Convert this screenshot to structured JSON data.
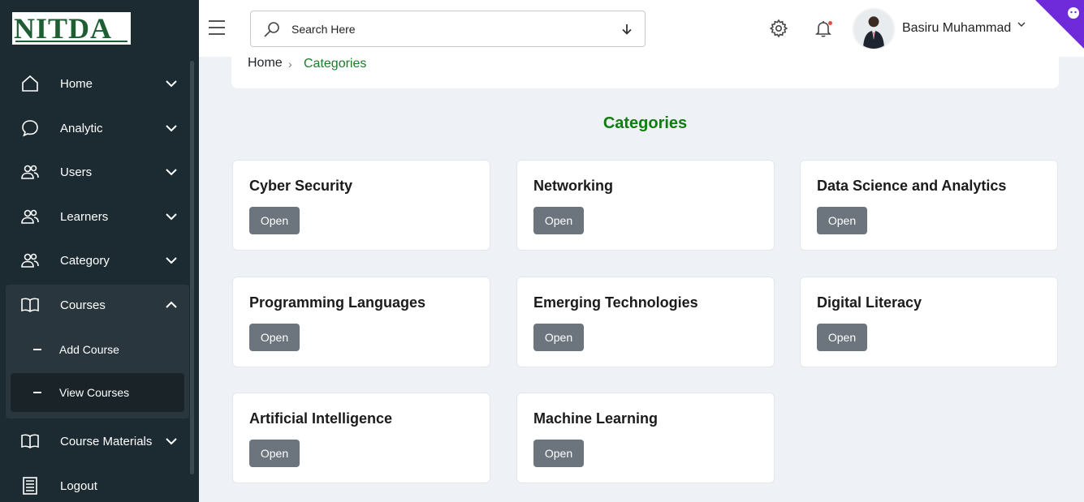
{
  "brand": {
    "logo_text": "NITDA"
  },
  "sidebar": {
    "items": [
      {
        "label": "Home",
        "icon": "home-icon"
      },
      {
        "label": "Analytic",
        "icon": "chat-bubble-icon"
      },
      {
        "label": "Users",
        "icon": "users-icon"
      },
      {
        "label": "Learners",
        "icon": "users-icon"
      },
      {
        "label": "Category",
        "icon": "users-icon"
      },
      {
        "label": "Courses",
        "icon": "book-icon",
        "expanded": true
      },
      {
        "label": "Course Materials",
        "icon": "book-icon"
      },
      {
        "label": "Logout",
        "icon": "list-icon"
      }
    ],
    "courses_sub": [
      {
        "label": "Add Course"
      },
      {
        "label": "View Courses",
        "active": true
      }
    ]
  },
  "header": {
    "search_placeholder": "Search Here",
    "user_name": "Basiru Muhammad"
  },
  "breadcrumb": {
    "home": "Home",
    "separator": "›",
    "current": "Categories"
  },
  "page": {
    "title": "Categories",
    "categories": [
      {
        "title": "Cyber Security",
        "button": "Open"
      },
      {
        "title": "Networking",
        "button": "Open"
      },
      {
        "title": "Data Science and Analytics",
        "button": "Open"
      },
      {
        "title": "Programming Languages",
        "button": "Open"
      },
      {
        "title": "Emerging Technologies",
        "button": "Open"
      },
      {
        "title": "Digital Literacy",
        "button": "Open"
      },
      {
        "title": "Artificial Intelligence",
        "button": "Open"
      },
      {
        "title": "Machine Learning",
        "button": "Open"
      }
    ]
  },
  "colors": {
    "sidebar_bg": "#1c2a31",
    "accent_green": "#107c10",
    "button_gray": "#6c757d",
    "notification_dot": "#e74c3c",
    "github_corner": "#6f2bd9"
  }
}
